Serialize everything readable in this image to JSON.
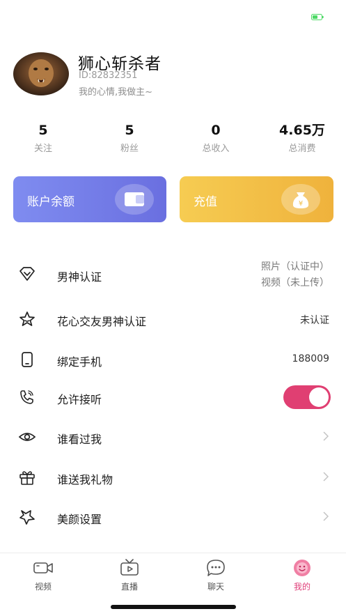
{
  "profile": {
    "name": "狮心斩杀者",
    "id_text": "ID:82832351",
    "mood": "我的心情,我做主~"
  },
  "stats": [
    {
      "value": "5",
      "label": "关注"
    },
    {
      "value": "5",
      "label": "粉丝"
    },
    {
      "value": "0",
      "label": "总收入"
    },
    {
      "value": "4.65万",
      "label": "总消费"
    }
  ],
  "cards": {
    "balance_label": "账户余额",
    "recharge_label": "充值",
    "balance_color": "#7480EC",
    "recharge_color": "#F2BE45"
  },
  "menu": {
    "god_cert": {
      "label": "男神认证",
      "value_line1": "照片（认证中）",
      "value_line2": "视频（未上传）"
    },
    "flower_cert": {
      "label": "花心交友男神认证",
      "value": "未认证"
    },
    "bind_phone": {
      "label": "绑定手机",
      "value": "188009"
    },
    "allow_answer": {
      "label": "允许接听",
      "enabled": true
    },
    "who_viewed": {
      "label": "谁看过我"
    },
    "who_gifted": {
      "label": "谁送我礼物"
    },
    "beauty": {
      "label": "美颜设置"
    }
  },
  "tabs": [
    {
      "label": "视频",
      "icon": "video-icon",
      "active": false
    },
    {
      "label": "直播",
      "icon": "tv-icon",
      "active": false
    },
    {
      "label": "聊天",
      "icon": "chat-icon",
      "active": false
    },
    {
      "label": "我的",
      "icon": "profile-icon",
      "active": true
    }
  ],
  "colors": {
    "accent": "#E0407A",
    "battery": "#4CD964"
  }
}
